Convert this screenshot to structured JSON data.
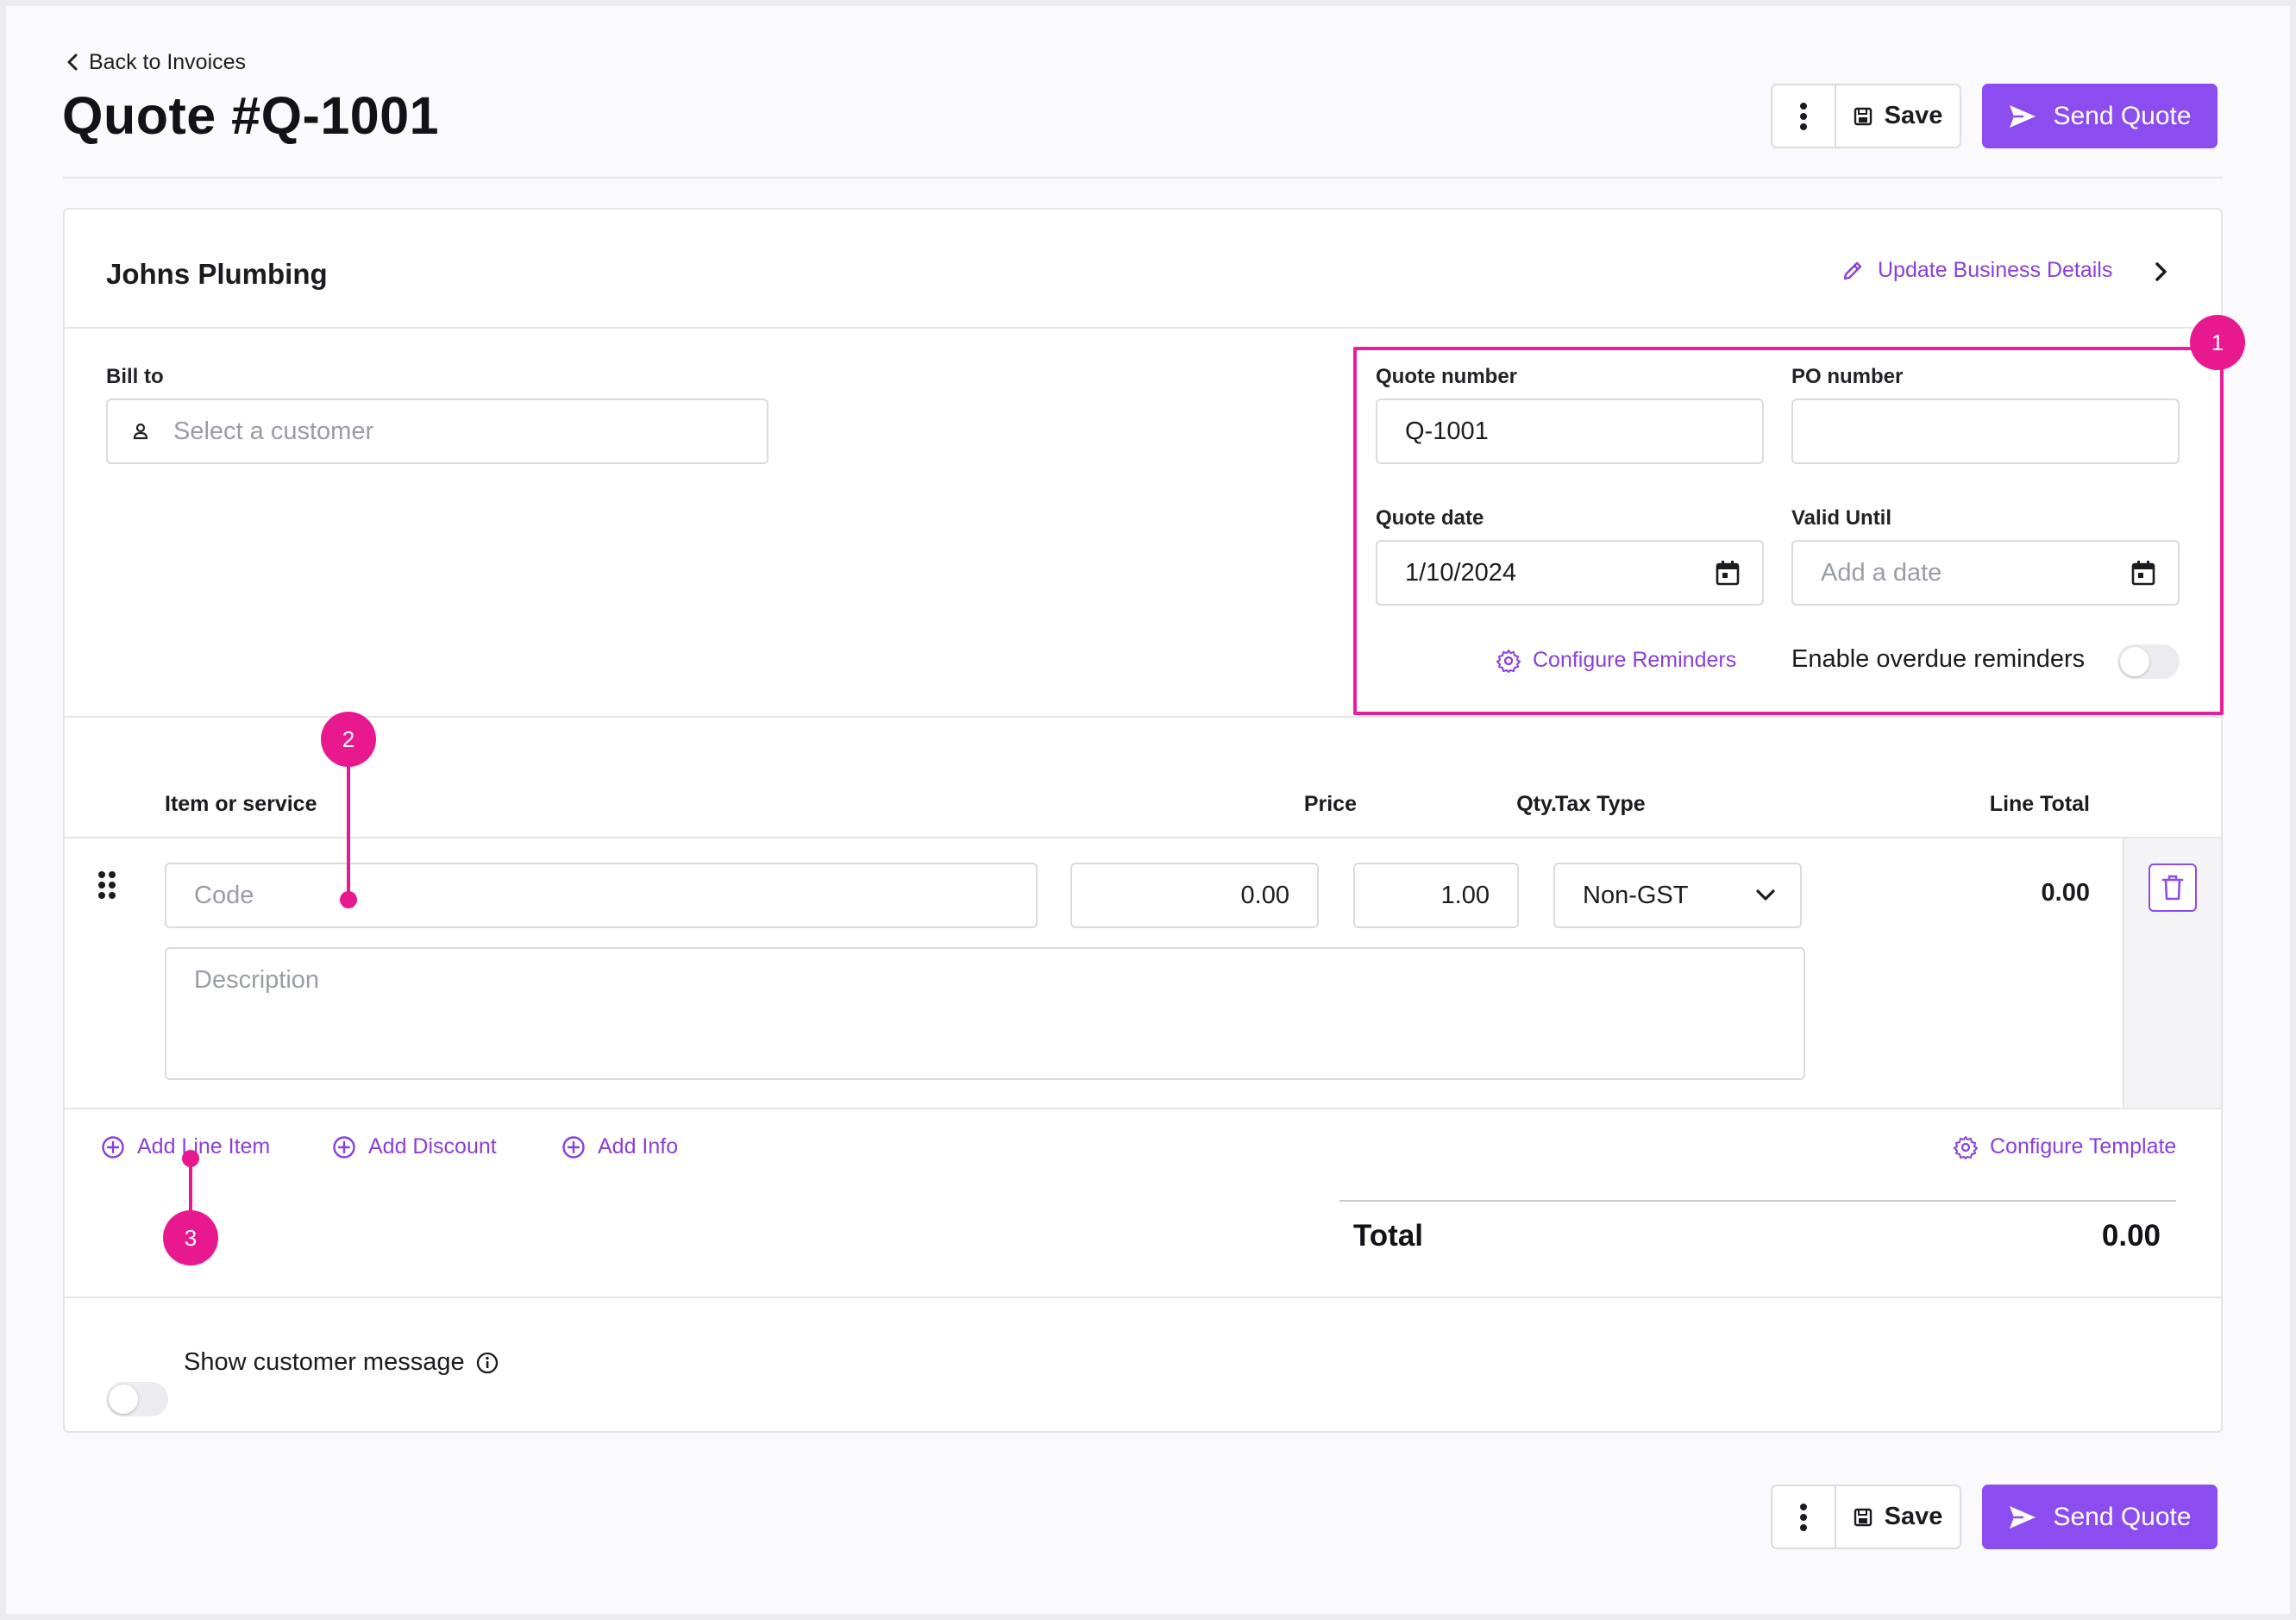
{
  "header": {
    "back_label": "Back to Invoices",
    "title": "Quote #Q-1001",
    "save_label": "Save",
    "send_label": "Send Quote"
  },
  "business": {
    "name": "Johns Plumbing",
    "update_label": "Update Business Details"
  },
  "bill_to": {
    "label": "Bill to",
    "placeholder": "Select a customer"
  },
  "quote_meta": {
    "quote_number_label": "Quote number",
    "quote_number_value": "Q-1001",
    "po_number_label": "PO number",
    "po_number_value": "",
    "quote_date_label": "Quote date",
    "quote_date_value": "1/10/2024",
    "valid_until_label": "Valid Until",
    "valid_until_placeholder": "Add a date",
    "configure_reminders_label": "Configure Reminders",
    "overdue_reminders_label": "Enable overdue reminders",
    "overdue_reminders_enabled": false
  },
  "line_items": {
    "columns": {
      "item": "Item or service",
      "price": "Price",
      "qty": "Qty.",
      "tax": "Tax Type",
      "total": "Line Total"
    },
    "rows": [
      {
        "code_placeholder": "Code",
        "description_placeholder": "Description",
        "price": "0.00",
        "qty": "1.00",
        "tax_type": "Non-GST",
        "line_total": "0.00"
      }
    ]
  },
  "actions": {
    "add_line_item": "Add Line Item",
    "add_discount": "Add Discount",
    "add_info": "Add Info",
    "configure_template": "Configure Template"
  },
  "totals": {
    "label": "Total",
    "value": "0.00"
  },
  "customer_message": {
    "label": "Show customer message",
    "enabled": false
  },
  "annotations": {
    "badge_1": "1",
    "badge_2": "2",
    "badge_3": "3",
    "highlight_color": "#e91e9b"
  },
  "colors": {
    "accent": "#8b4cf0",
    "link": "#8b3fd9",
    "annotation": "#e8198f"
  }
}
